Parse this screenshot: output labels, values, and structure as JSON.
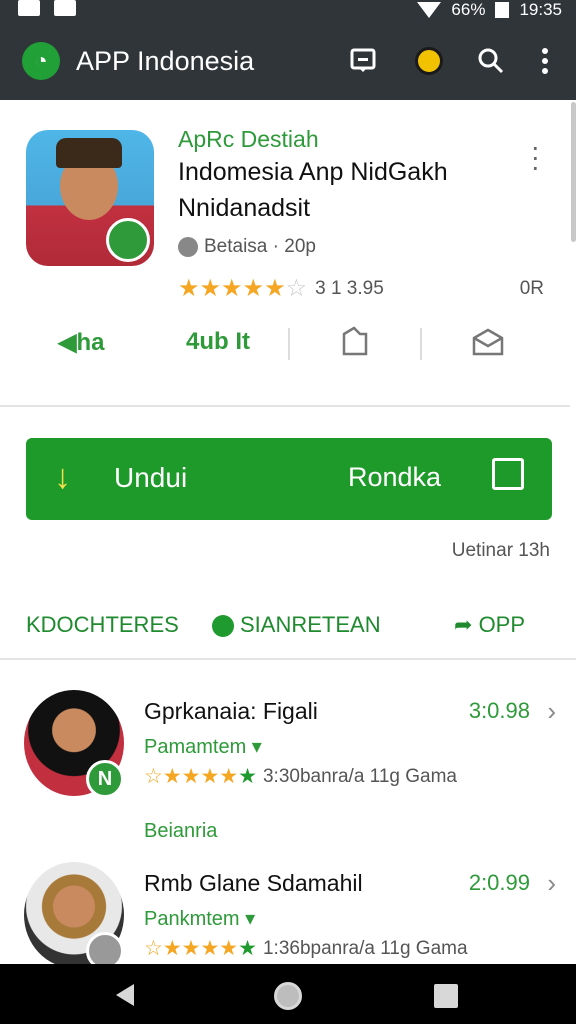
{
  "statusbar": {
    "battery": "66%",
    "time": "19:35"
  },
  "appbar": {
    "title": "APP Indonesia"
  },
  "app": {
    "developer": "ApRc Destiah",
    "name_line1": "Indomesia Anp NidGakh",
    "name_line2": "Nnidanadsit",
    "meta": "Betaisa · 20p",
    "rating_count": "3 1 3.95",
    "or_label": "0R",
    "rating_fraction": 0.9
  },
  "actions": {
    "a1": "ha",
    "a2": "4ub It"
  },
  "install": {
    "label": "Undui",
    "label2": "Rondka"
  },
  "updated": "Uetinar 13h",
  "tabs": {
    "tab1": "KDOCHTERES",
    "tab2": "SIANRETEAN",
    "tab3": "OPP"
  },
  "list": [
    {
      "title": "Gprkanaia: Figali",
      "sub": "Pamamtem",
      "price": "3:0.98",
      "stars_text": "3:30banra/a 11g Gama",
      "badge": "N"
    },
    {
      "title": "Rmb Glane Sdamahil",
      "sub": "Pankmtem",
      "price": "2:0.99",
      "stars_text": "1:36bpanra/a 11g Gama",
      "badge": ""
    }
  ],
  "section_label": "Beianria",
  "colors": {
    "accent": "#1e9a2a",
    "appbar": "#2f3539"
  }
}
